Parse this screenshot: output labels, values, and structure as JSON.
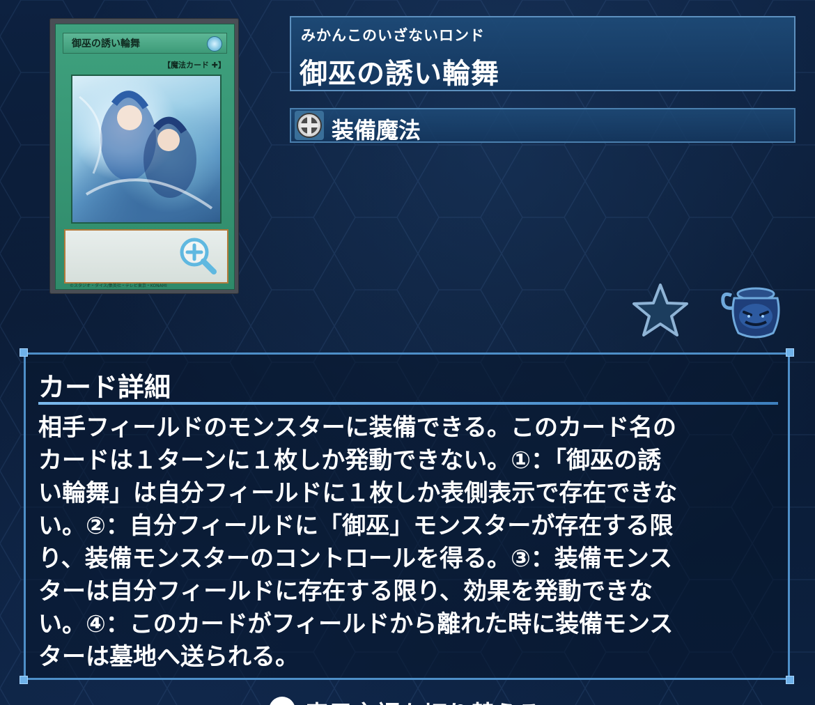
{
  "card": {
    "image_name_text": "御巫の誘い輪舞",
    "image_type_text": "【魔法カード ✚】",
    "image_copyright": "©スタジオ・ダイス/集英社・テレビ東京・KONAMI"
  },
  "name": {
    "ruby": "みかんこのいざないロンド",
    "title": "御巫の誘い輪舞"
  },
  "type": {
    "icon": "equip-spell-icon",
    "label": "装備魔法"
  },
  "actions": {
    "favorite_icon": "star-icon",
    "pot_icon": "pot-of-greed-icon"
  },
  "detail": {
    "title": "カード詳細",
    "text": "相手フィールドのモンスターに装備できる。このカード名の\nカードは１ターンに１枚しか発動できない。①：「御巫の誘\nい輪舞」は自分フィールドに１枚しか表側表示で存在できな\nい。②：自分フィールドに「御巫」モンスターが存在する限\nり、装備モンスターのコントロールを得る。③：装備モンス\nターは自分フィールドに存在する限り、効果を発動できな\nい。④：このカードがフィールドから離れた時に装備モンス\nターは墓地へ送られる。"
  },
  "footer": {
    "partial_text": "表示言語を切り替える"
  },
  "colors": {
    "background": "#0b1d37",
    "panel_border": "#5d90bf",
    "detail_border": "#4e8fc8",
    "spell_green": "#3fa17e"
  }
}
